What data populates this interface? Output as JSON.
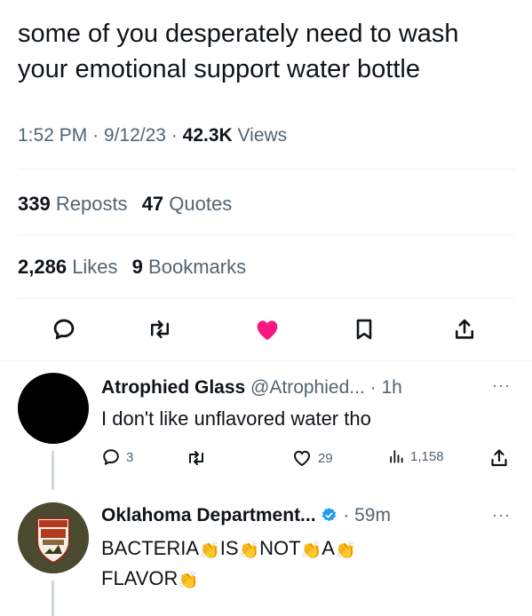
{
  "tweet": {
    "text_line1": "some of you desperately need to wash",
    "text_line2": "your emotional support water bottle",
    "time": "1:52 PM",
    "date": "9/12/23",
    "views_count": "42.3K",
    "views_label": "Views",
    "reposts_count": "339",
    "reposts_label": "Reposts",
    "quotes_count": "47",
    "quotes_label": "Quotes",
    "likes_count": "2,286",
    "likes_label": "Likes",
    "bookmarks_count": "9",
    "bookmarks_label": "Bookmarks",
    "liked_color": "#f91880"
  },
  "replies": [
    {
      "name": "Atrophied Glass",
      "handle": "@Atrophied...",
      "time": "1h",
      "text": "I don't like unflavored water tho",
      "reply_count": "3",
      "like_count": "29",
      "view_count": "1,158",
      "avatar_color": "#000000"
    },
    {
      "name": "Oklahoma Department...",
      "time": "59m",
      "verified": true,
      "words": [
        "BACTERIA",
        "IS",
        "NOT",
        "A"
      ],
      "line2_word": "FLAVOR",
      "clap_emoji": "👏",
      "avatar_color": "#4a4a2e"
    }
  ],
  "icons": [
    "reply-icon",
    "repost-icon",
    "heart-icon",
    "bookmark-icon",
    "share-icon",
    "views-icon",
    "more-icon",
    "verified-icon"
  ]
}
